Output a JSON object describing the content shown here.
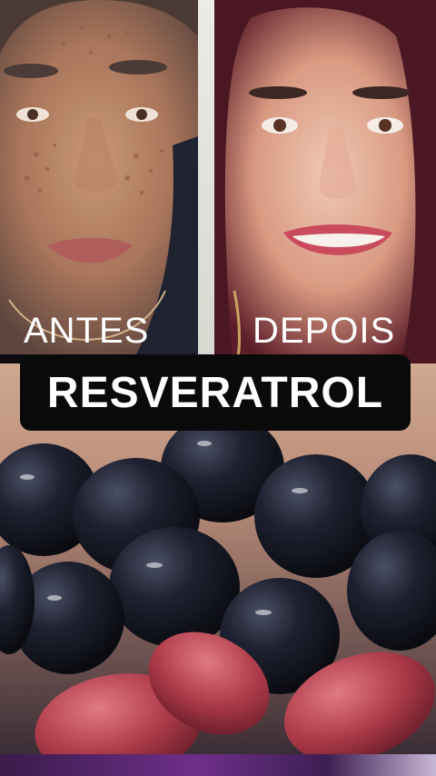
{
  "photo_before": {
    "caption": "ANTES"
  },
  "photo_after": {
    "caption": "DEPOIS"
  },
  "title_banner": {
    "text": "RESVERATROL"
  },
  "scene": {
    "subject": "grapes-photo"
  },
  "colors": {
    "banner_bg": "#0a0a0a",
    "caption_text": "#ffffff",
    "grape_dark": "#1c1f2a",
    "grape_red": "#b44a55"
  }
}
